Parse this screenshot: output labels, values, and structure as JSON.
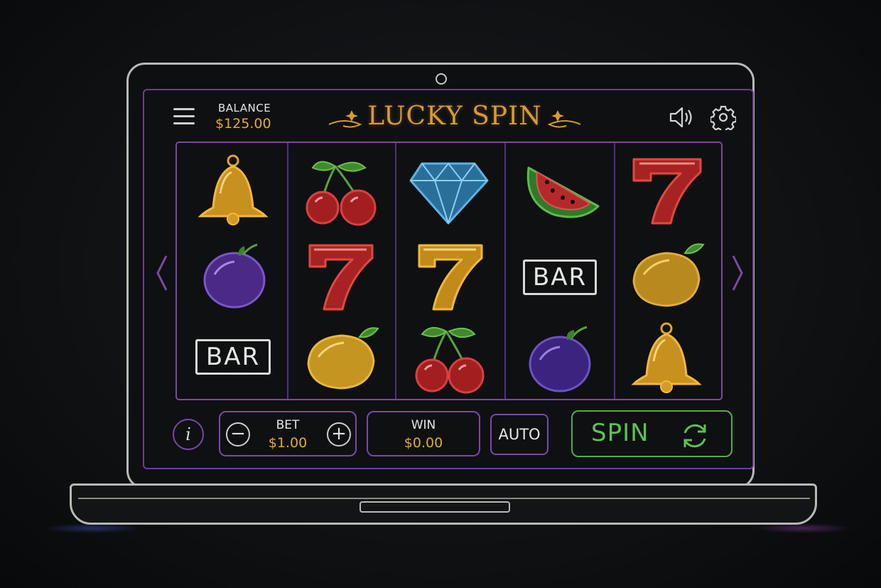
{
  "header": {
    "balance_label": "BALANCE",
    "balance_value": "$125.00",
    "title": "LUCKY SPIN"
  },
  "icons": {
    "menu": "hamburger-menu-icon",
    "sound": "speaker-icon",
    "settings": "gear-icon",
    "left_arrow": "chevron-left-icon",
    "right_arrow": "chevron-right-icon",
    "info": "info-icon",
    "spin": "refresh-icon"
  },
  "reels": [
    [
      "bell",
      "plum",
      "bar"
    ],
    [
      "cherries",
      "seven",
      "lemon"
    ],
    [
      "diamond",
      "seven",
      "cherries"
    ],
    [
      "watermelon",
      "bar",
      "plum"
    ],
    [
      "seven",
      "lemon",
      "bell"
    ]
  ],
  "bar_text": "BAR",
  "controls": {
    "info_label": "i",
    "bet_label": "BET",
    "bet_value": "$1.00",
    "minus_label": "−",
    "plus_label": "+",
    "win_label": "WIN",
    "win_value": "$0.00",
    "auto_label": "AUTO",
    "spin_label": "SPIN"
  },
  "colors": {
    "accent_purple": "#7b48a4",
    "gold": "#e5a92e",
    "spin_green": "#5cc252",
    "title_gold": "#d99a32"
  }
}
